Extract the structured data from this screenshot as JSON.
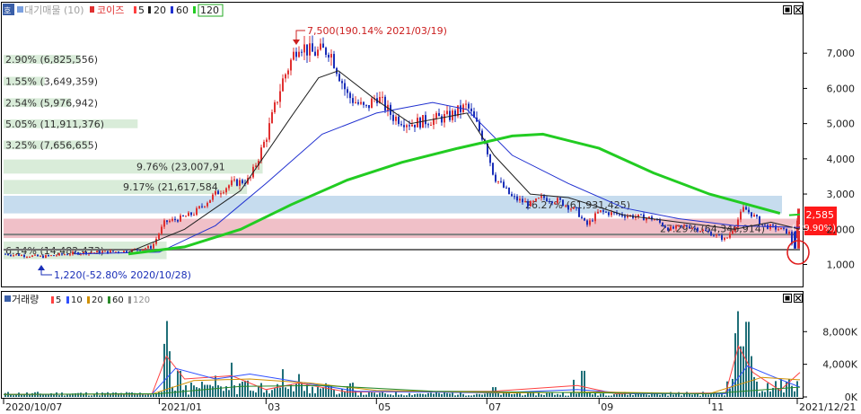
{
  "colors": {
    "up": "#e03030",
    "down": "#1a2fb8",
    "ma5": "#ff4040",
    "ma20": "#202020",
    "ma60": "#2030d0",
    "ma120": "#22cc22",
    "vol_ma10": "#3050ff",
    "vol_ma20": "#d09000",
    "vol_ma60": "#2a8a2a",
    "vol_ma120": "#909090",
    "band_green": "#d9ecd9",
    "band_blue": "#c6dcee",
    "band_pink": "#f0c0c8",
    "price_tag_bg": "#ff1a1a",
    "annot_red": "#cc2020",
    "annot_blue": "#1a2fb8"
  },
  "price_panel": {
    "legend": {
      "tab": "호",
      "name": "대기매물 (10)",
      "series_label": "코이즈",
      "ma_labels": [
        "5",
        "20",
        "60",
        "120"
      ]
    },
    "y_ticks": [
      "7,000",
      "6,000",
      "5,000",
      "4,000",
      "3,000",
      "2,000",
      "1,000"
    ],
    "volume_profile": [
      {
        "label": "2.90% (6,825,556)",
        "pct": 2.9
      },
      {
        "label": "1.55% (3,649,359)",
        "pct": 1.55
      },
      {
        "label": "2.54% (5,976,942)",
        "pct": 2.54
      },
      {
        "label": "5.05% (11,911,376)",
        "pct": 5.05
      },
      {
        "label": "3.25% (7,656,655)",
        "pct": 3.25
      },
      {
        "label": "9.76% (23,007,91",
        "pct": 9.76
      },
      {
        "label": "9.17% (21,617,584",
        "pct": 9.17
      },
      {
        "label": "26.27% (61,931,425)",
        "pct": 26.27
      },
      {
        "label": "27.29% (64,346,914)",
        "pct": 27.29
      },
      {
        "label": "6.14% (14,482,473)",
        "pct": 6.14
      }
    ],
    "high_annotation": "7,500(190.14% 2021/03/19)",
    "low_annotation": "1,220(-52.80% 2020/10/28)",
    "price_tag": {
      "price": "2,585",
      "change": "( 29.90%)"
    }
  },
  "volume_panel": {
    "legend": {
      "series_label": "거래량",
      "ma_labels": [
        "5",
        "10",
        "20",
        "60",
        "120"
      ]
    },
    "y_ticks": [
      "8,000K",
      "4,000K",
      "0K"
    ]
  },
  "x_axis": {
    "ticks": [
      "2020/10/07",
      "2021/01",
      "03",
      "05",
      "07",
      "09",
      "11",
      "2021/12/21"
    ]
  },
  "chart_data": {
    "type": "line",
    "title": "코이즈",
    "ylim": [
      400,
      8000
    ],
    "volume_ylim": [
      0,
      11000
    ],
    "date_range": [
      "2020/10/07",
      "2021/12/21"
    ],
    "close": [
      [
        "2020/10/07",
        1300
      ],
      [
        "2020/10/28",
        1220
      ],
      [
        "2020/11/15",
        1320
      ],
      [
        "2020/12/15",
        1380
      ],
      [
        "2020/12/28",
        1500
      ],
      [
        "2021/01/04",
        2200
      ],
      [
        "2021/01/12",
        2300
      ],
      [
        "2021/01/20",
        2450
      ],
      [
        "2021/02/01",
        3000
      ],
      [
        "2021/02/10",
        3300
      ],
      [
        "2021/02/20",
        3400
      ],
      [
        "2021/03/01",
        4600
      ],
      [
        "2021/03/10",
        6200
      ],
      [
        "2021/03/19",
        7300
      ],
      [
        "2021/03/26",
        7000
      ],
      [
        "2021/04/05",
        7100
      ],
      [
        "2021/04/15",
        5800
      ],
      [
        "2021/04/25",
        5400
      ],
      [
        "2021/05/01",
        5800
      ],
      [
        "2021/05/10",
        5200
      ],
      [
        "2021/05/20",
        5000
      ],
      [
        "2021/05/30",
        5100
      ],
      [
        "2021/06/10",
        5200
      ],
      [
        "2021/06/20",
        5500
      ],
      [
        "2021/06/30",
        4500
      ],
      [
        "2021/07/05",
        3500
      ],
      [
        "2021/07/15",
        2900
      ],
      [
        "2021/07/25",
        2700
      ],
      [
        "2021/08/01",
        2900
      ],
      [
        "2021/08/10",
        2800
      ],
      [
        "2021/08/20",
        2500
      ],
      [
        "2021/08/25",
        2100
      ],
      [
        "2021/09/01",
        2500
      ],
      [
        "2021/09/15",
        2400
      ],
      [
        "2021/10/01",
        2300
      ],
      [
        "2021/10/10",
        2000
      ],
      [
        "2021/10/20",
        2100
      ],
      [
        "2021/11/01",
        1900
      ],
      [
        "2021/11/10",
        1700
      ],
      [
        "2021/11/15",
        2100
      ],
      [
        "2021/11/20",
        2600
      ],
      [
        "2021/11/25",
        2400
      ],
      [
        "2021/12/01",
        2100
      ],
      [
        "2021/12/10",
        2000
      ],
      [
        "2021/12/15",
        1900
      ],
      [
        "2021/12/17",
        1500
      ],
      [
        "2021/12/21",
        2585
      ]
    ],
    "ma120": [
      [
        "2020/12/15",
        1300
      ],
      [
        "2021/01/15",
        1500
      ],
      [
        "2021/02/15",
        2000
      ],
      [
        "2021/03/15",
        2700
      ],
      [
        "2021/04/15",
        3400
      ],
      [
        "2021/05/15",
        3900
      ],
      [
        "2021/06/15",
        4300
      ],
      [
        "2021/07/15",
        4650
      ],
      [
        "2021/08/01",
        4700
      ],
      [
        "2021/09/01",
        4300
      ],
      [
        "2021/10/01",
        3600
      ],
      [
        "2021/11/01",
        3000
      ],
      [
        "2021/12/10",
        2450
      ]
    ],
    "ma60": [
      [
        "2020/11/15",
        1300
      ],
      [
        "2021/01/01",
        1350
      ],
      [
        "2021/02/01",
        2100
      ],
      [
        "2021/03/01",
        3300
      ],
      [
        "2021/04/01",
        4700
      ],
      [
        "2021/05/01",
        5300
      ],
      [
        "2021/06/01",
        5600
      ],
      [
        "2021/06/20",
        5400
      ],
      [
        "2021/07/15",
        4100
      ],
      [
        "2021/08/15",
        3300
      ],
      [
        "2021/09/15",
        2600
      ],
      [
        "2021/10/15",
        2300
      ],
      [
        "2021/11/15",
        2100
      ],
      [
        "2021/12/21",
        2050
      ]
    ],
    "ma20": [
      [
        "2020/12/15",
        1350
      ],
      [
        "2021/01/15",
        2000
      ],
      [
        "2021/02/15",
        3100
      ],
      [
        "2021/03/15",
        5200
      ],
      [
        "2021/03/30",
        6300
      ],
      [
        "2021/04/10",
        6500
      ],
      [
        "2021/04/30",
        5700
      ],
      [
        "2021/05/20",
        5000
      ],
      [
        "2021/06/20",
        5300
      ],
      [
        "2021/07/05",
        4100
      ],
      [
        "2021/07/25",
        3000
      ],
      [
        "2021/08/15",
        2900
      ],
      [
        "2021/09/15",
        2400
      ],
      [
        "2021/10/15",
        2200
      ],
      [
        "2021/11/15",
        2000
      ],
      [
        "2021/12/05",
        2200
      ],
      [
        "2021/12/21",
        2000
      ]
    ],
    "volume_spikes_k": [
      [
        "2021/01/04",
        6500
      ],
      [
        "2021/01/05",
        9300
      ],
      [
        "2021/01/06",
        5600
      ],
      [
        "2021/01/12",
        3200
      ],
      [
        "2021/02/01",
        2600
      ],
      [
        "2021/02/10",
        4200
      ],
      [
        "2021/02/18",
        2000
      ],
      [
        "2021/03/10",
        3400
      ],
      [
        "2021/03/19",
        2800
      ],
      [
        "2021/04/05",
        1500
      ],
      [
        "2021/07/05",
        1200
      ],
      [
        "2021/08/18",
        2100
      ],
      [
        "2021/08/23",
        3200
      ],
      [
        "2021/11/15",
        7800
      ],
      [
        "2021/11/17",
        10500
      ],
      [
        "2021/11/19",
        6200
      ],
      [
        "2021/11/22",
        9200
      ],
      [
        "2021/11/24",
        5000
      ],
      [
        "2021/12/21",
        8600
      ]
    ]
  }
}
